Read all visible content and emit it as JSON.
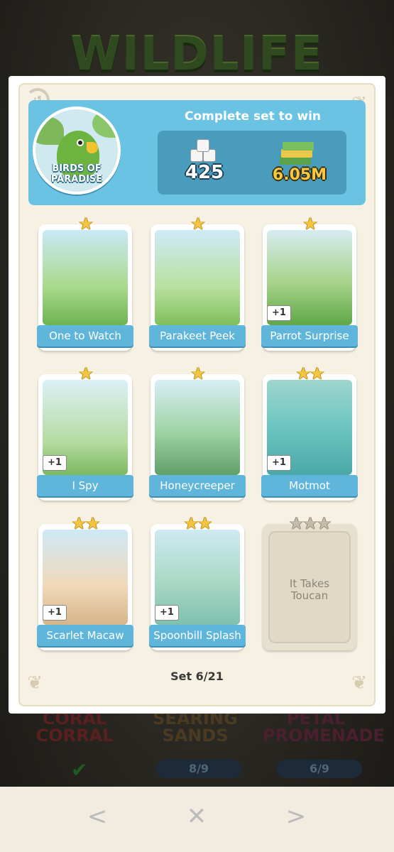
{
  "background": {
    "title": "WILDLIFE",
    "sets": [
      {
        "name": "CORAL CORRAL"
      },
      {
        "name": "SEARING SANDS",
        "progress": "8/9"
      },
      {
        "name": "PETAL PROMENADE",
        "progress": "6/9"
      }
    ]
  },
  "header": {
    "set_name": "BIRDS OF PARADISE",
    "complete_text": "Complete set to win",
    "reward_dice": "425",
    "reward_cash": "6.05M"
  },
  "cards": [
    {
      "name": "One to Watch",
      "stars": "★",
      "plus": ""
    },
    {
      "name": "Parakeet Peek",
      "stars": "★",
      "plus": ""
    },
    {
      "name": "Parrot Surprise",
      "stars": "★",
      "plus": "+1"
    },
    {
      "name": "I Spy",
      "stars": "★",
      "plus": "+1"
    },
    {
      "name": "Honeycreeper",
      "stars": "★",
      "plus": ""
    },
    {
      "name": "Motmot",
      "stars": "★★",
      "plus": "+1"
    },
    {
      "name": "Scarlet Macaw",
      "stars": "★★",
      "plus": "+1"
    },
    {
      "name": "Spoonbill Splash",
      "stars": "★★",
      "plus": "+1"
    },
    {
      "name": "It Takes Toucan",
      "stars": "★★★",
      "plus": "",
      "locked": true
    }
  ],
  "set_count": "Set 6/21",
  "nav": {
    "prev_icon": "<",
    "close_icon": "✕",
    "next_icon": ">"
  },
  "colors": {
    "header_blue": "#6ac3e3",
    "label_blue": "#5fb6da",
    "star_gold": "#f4c542",
    "cash_gold": "#f6c945"
  }
}
